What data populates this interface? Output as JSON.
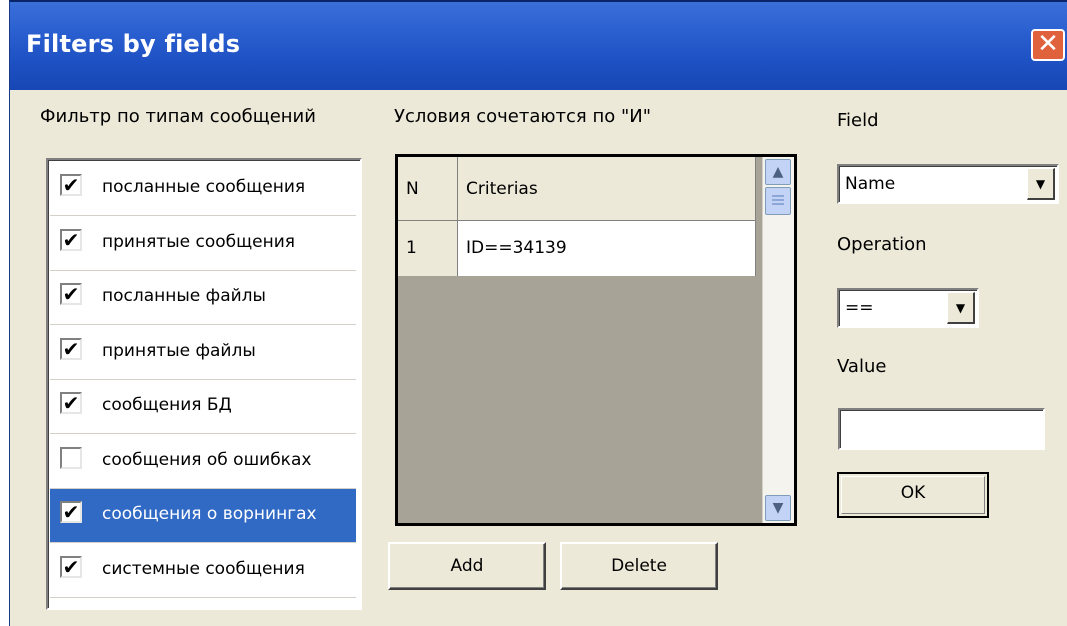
{
  "window": {
    "title": "Filters by fields",
    "close_glyph": "✕"
  },
  "left_panel": {
    "heading": "Фильтр по типам сообщений",
    "items": [
      {
        "label": "посланные сообщения",
        "checked": true
      },
      {
        "label": "принятые сообщения",
        "checked": true
      },
      {
        "label": "посланные файлы",
        "checked": true
      },
      {
        "label": "принятые файлы",
        "checked": true
      },
      {
        "label": "сообщения БД",
        "checked": true
      },
      {
        "label": "сообщения об ошибках",
        "checked": false
      },
      {
        "label": "сообщения о ворнингах",
        "checked": true,
        "selected": true
      },
      {
        "label": "системные сообщения",
        "checked": true
      }
    ]
  },
  "middle_panel": {
    "heading": "Условия сочетаются по \"И\"",
    "grid": {
      "columns": [
        "N",
        "Criterias"
      ],
      "rows": [
        [
          "1",
          "ID==34139"
        ]
      ]
    },
    "add_label": "Add",
    "delete_label": "Delete"
  },
  "right_panel": {
    "field_label": "Field",
    "field_value": "Name",
    "operation_label": "Operation",
    "operation_value": "==",
    "value_label": "Value",
    "value_text": "",
    "ok_label": "OK"
  },
  "colors": {
    "titlebar": "#1d50c2",
    "selection": "#316ac5",
    "face": "#ece9d8",
    "grid_empty": "#a7a497"
  },
  "icons": {
    "check": "check-mark-icon",
    "dropdown": "chevron-down-icon",
    "scroll_up": "arrow-up-icon",
    "scroll_down": "arrow-down-icon",
    "close": "close-icon"
  }
}
